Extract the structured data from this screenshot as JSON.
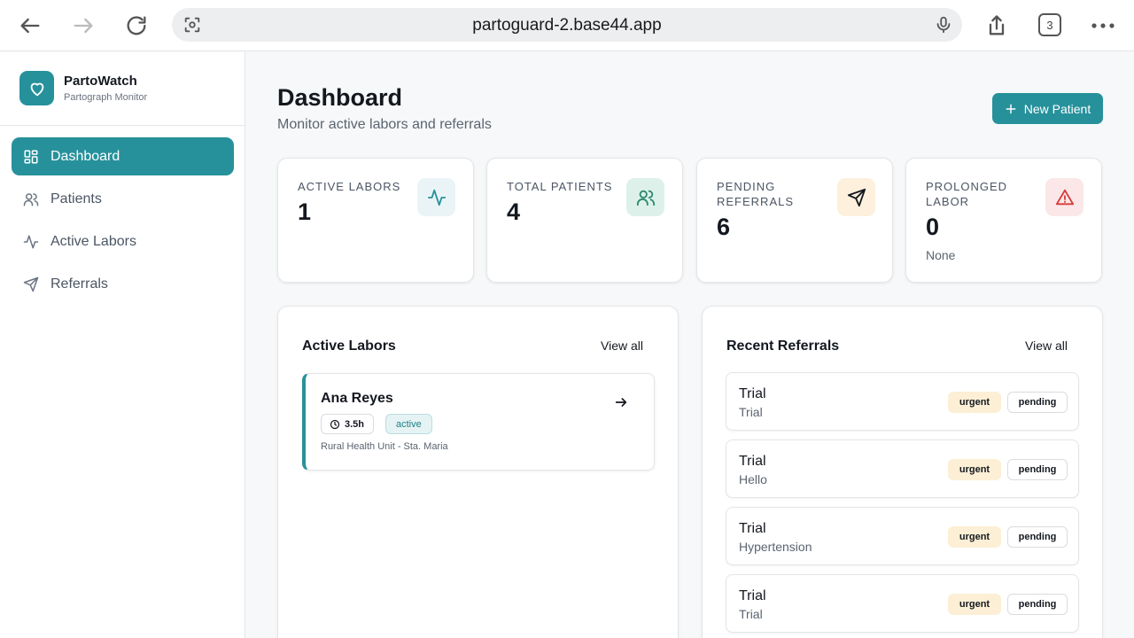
{
  "browser": {
    "url": "partoguard-2.base44.app",
    "tab_count": "3"
  },
  "brand": {
    "name": "PartoWatch",
    "subtitle": "Partograph Monitor"
  },
  "sidebar": {
    "items": [
      {
        "label": "Dashboard",
        "icon": "grid-icon",
        "active": true
      },
      {
        "label": "Patients",
        "icon": "users-icon",
        "active": false
      },
      {
        "label": "Active Labors",
        "icon": "activity-icon",
        "active": false
      },
      {
        "label": "Referrals",
        "icon": "send-icon",
        "active": false
      }
    ]
  },
  "header": {
    "title": "Dashboard",
    "subtitle": "Monitor active labors and referrals",
    "new_patient_label": "New Patient"
  },
  "stats": [
    {
      "label": "ACTIVE LABORS",
      "value": "1",
      "note": "",
      "icon": "activity-icon",
      "color": "#26919b",
      "bg": "#eaf4f6"
    },
    {
      "label": "TOTAL PATIENTS",
      "value": "4",
      "note": "",
      "icon": "users-icon",
      "color": "#2c8a6e",
      "bg": "#ddf1ea"
    },
    {
      "label": "PENDING REFERRALS",
      "value": "6",
      "note": "",
      "icon": "send-icon",
      "color": "#14181f",
      "bg": "#fdf0dc"
    },
    {
      "label": "PROLONGED LABOR",
      "value": "0",
      "note": "None",
      "icon": "alert-triangle-icon",
      "color": "#d63b3b",
      "bg": "#fbe7e7"
    }
  ],
  "active_labors": {
    "title": "Active Labors",
    "view_all": "View all",
    "items": [
      {
        "name": "Ana Reyes",
        "duration": "3.5h",
        "status": "active",
        "facility": "Rural Health Unit - Sta. Maria"
      }
    ]
  },
  "referrals": {
    "title": "Recent Referrals",
    "view_all": "View all",
    "items": [
      {
        "name": "Trial",
        "reason": "Trial",
        "priority": "urgent",
        "status": "pending"
      },
      {
        "name": "Trial",
        "reason": "Hello",
        "priority": "urgent",
        "status": "pending"
      },
      {
        "name": "Trial",
        "reason": "Hypertension",
        "priority": "urgent",
        "status": "pending"
      },
      {
        "name": "Trial",
        "reason": "Trial",
        "priority": "urgent",
        "status": "pending"
      }
    ]
  }
}
